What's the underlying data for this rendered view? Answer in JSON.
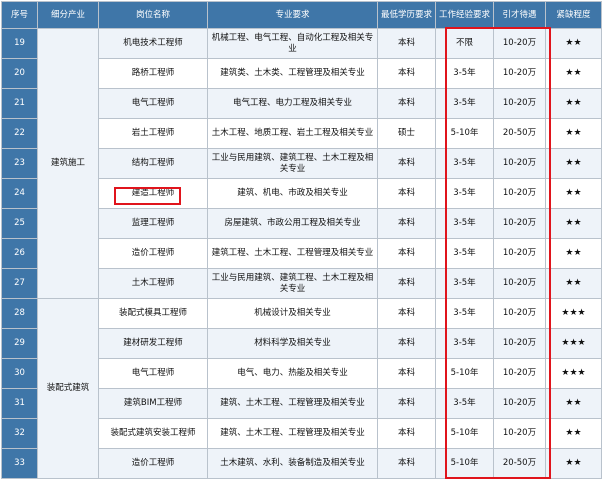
{
  "headers": [
    "序号",
    "细分产业",
    "岗位名称",
    "专业要求",
    "最低学历要求",
    "工作经验要求",
    "引才待遇",
    "紧缺程度"
  ],
  "groups": [
    {
      "industry": "建筑施工",
      "rows": [
        {
          "no": "19",
          "title": "机电技术工程师",
          "major": "机械工程、电气工程、自动化工程及相关专业",
          "edu": "本科",
          "exp": "不限",
          "pay": "10-20万",
          "level": "★★"
        },
        {
          "no": "20",
          "title": "路桥工程师",
          "major": "建筑类、土木类、工程管理及相关专业",
          "edu": "本科",
          "exp": "3-5年",
          "pay": "10-20万",
          "level": "★★"
        },
        {
          "no": "21",
          "title": "电气工程师",
          "major": "电气工程、电力工程及相关专业",
          "edu": "本科",
          "exp": "3-5年",
          "pay": "10-20万",
          "level": "★★"
        },
        {
          "no": "22",
          "title": "岩土工程师",
          "major": "土木工程、地质工程、岩土工程及相关专业",
          "edu": "硕士",
          "exp": "5-10年",
          "pay": "20-50万",
          "level": "★★"
        },
        {
          "no": "23",
          "title": "结构工程师",
          "major": "工业与民用建筑、建筑工程、土木工程及相关专业",
          "edu": "本科",
          "exp": "3-5年",
          "pay": "10-20万",
          "level": "★★"
        },
        {
          "no": "24",
          "title": "建造工程师",
          "major": "建筑、机电、市政及相关专业",
          "edu": "本科",
          "exp": "3-5年",
          "pay": "10-20万",
          "level": "★★"
        },
        {
          "no": "25",
          "title": "监理工程师",
          "major": "房屋建筑、市政公用工程及相关专业",
          "edu": "本科",
          "exp": "3-5年",
          "pay": "10-20万",
          "level": "★★"
        },
        {
          "no": "26",
          "title": "造价工程师",
          "major": "建筑工程、土木工程、工程管理及相关专业",
          "edu": "本科",
          "exp": "3-5年",
          "pay": "10-20万",
          "level": "★★"
        },
        {
          "no": "27",
          "title": "土木工程师",
          "major": "工业与民用建筑、建筑工程、土木工程及相关专业",
          "edu": "本科",
          "exp": "3-5年",
          "pay": "10-20万",
          "level": "★★"
        }
      ]
    },
    {
      "industry": "装配式建筑",
      "rows": [
        {
          "no": "28",
          "title": "装配式模具工程师",
          "major": "机械设计及相关专业",
          "edu": "本科",
          "exp": "3-5年",
          "pay": "10-20万",
          "level": "★★★"
        },
        {
          "no": "29",
          "title": "建材研发工程师",
          "major": "材料科学及相关专业",
          "edu": "本科",
          "exp": "3-5年",
          "pay": "10-20万",
          "level": "★★★"
        },
        {
          "no": "30",
          "title": "电气工程师",
          "major": "电气、电力、热能及相关专业",
          "edu": "本科",
          "exp": "5-10年",
          "pay": "10-20万",
          "level": "★★★"
        },
        {
          "no": "31",
          "title": "建筑BIM工程师",
          "major": "建筑、土木工程、工程管理及相关专业",
          "edu": "本科",
          "exp": "3-5年",
          "pay": "10-20万",
          "level": "★★"
        },
        {
          "no": "32",
          "title": "装配式建筑安装工程师",
          "major": "建筑、土木工程、工程管理及相关专业",
          "edu": "本科",
          "exp": "5-10年",
          "pay": "10-20万",
          "level": "★★"
        },
        {
          "no": "33",
          "title": "造价工程师",
          "major": "土木建筑、水利、装备制造及相关专业",
          "edu": "本科",
          "exp": "5-10年",
          "pay": "20-50万",
          "level": "★★"
        }
      ]
    }
  ]
}
